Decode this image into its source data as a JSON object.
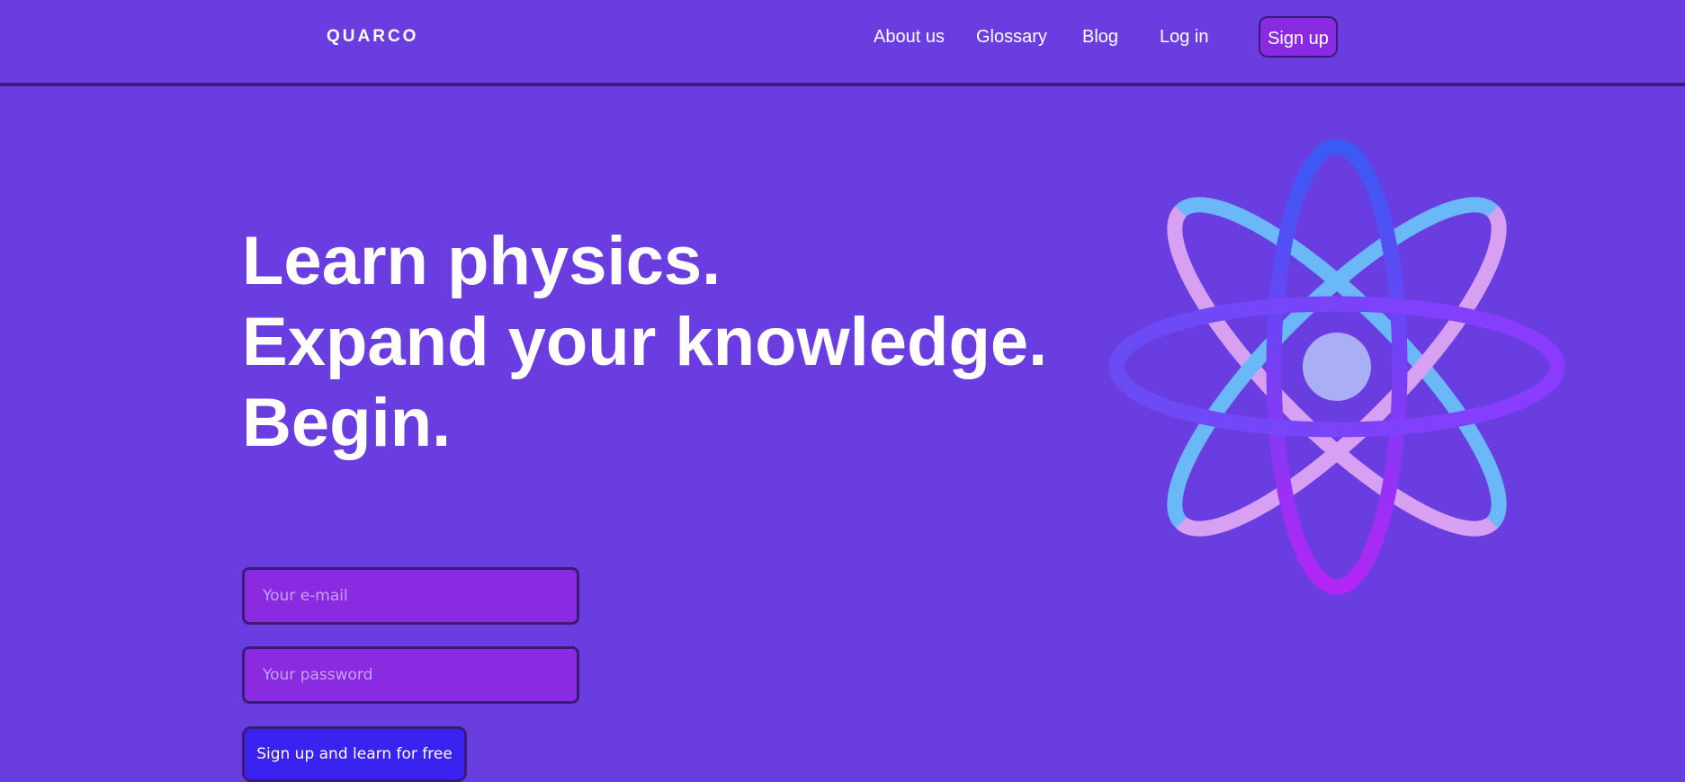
{
  "header": {
    "logo": "QUARCO",
    "nav": {
      "about": "About us",
      "glossary": "Glossary",
      "blog": "Blog",
      "login": "Log in",
      "signup": "Sign up"
    }
  },
  "hero": {
    "line1": "Learn physics.",
    "line2": "Expand your knowledge.",
    "line3": "Begin."
  },
  "form": {
    "email_placeholder": "Your e-mail",
    "password_placeholder": "Your password",
    "submit_label": "Sign up and learn for free"
  },
  "colors": {
    "background": "#6a3de0",
    "accent_button": "#8a2be2",
    "cta_button": "#3a22f0",
    "border": "#3b1a7a"
  },
  "icons": {
    "hero_graphic": "atom-icon"
  }
}
